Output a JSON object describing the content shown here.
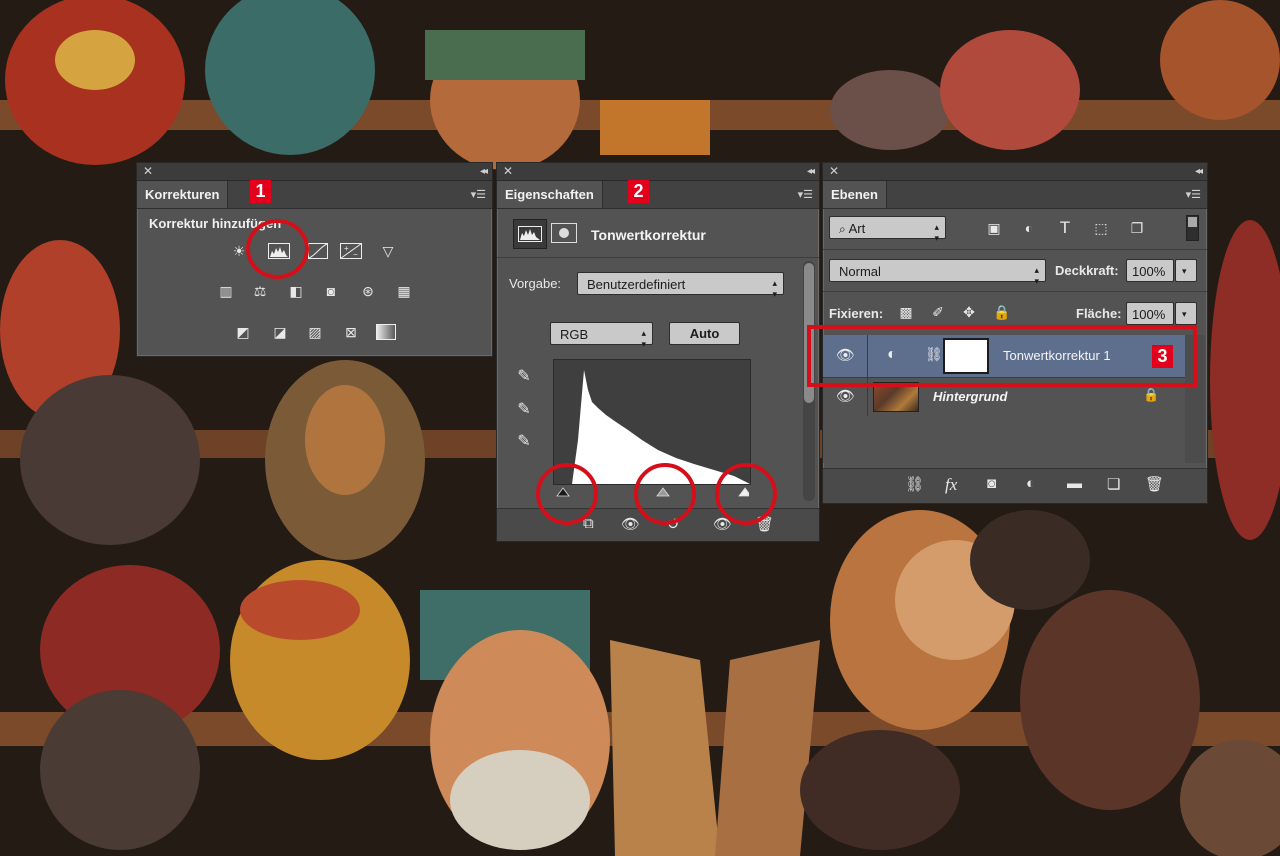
{
  "panels": {
    "korrekturen": {
      "tab_label": "Korrekturen",
      "section_title": "Korrektur hinzufügen",
      "badge": "1"
    },
    "eigenschaften": {
      "tab_label": "Eigenschaften",
      "badge": "2",
      "title": "Tonwertkorrektur",
      "preset_label": "Vorgabe:",
      "preset_value": "Benutzerdefiniert",
      "channel_value": "RGB",
      "auto_label": "Auto"
    },
    "ebenen": {
      "tab_label": "Ebenen",
      "badge": "3",
      "filter_value": "Art",
      "blend_mode": "Normal",
      "opacity_label": "Deckkraft:",
      "opacity_value": "100%",
      "lock_label": "Fixieren:",
      "fill_label": "Fläche:",
      "fill_value": "100%",
      "layers": [
        {
          "name": "Tonwertkorrektur 1",
          "selected": true
        },
        {
          "name": "Hintergrund",
          "selected": false
        }
      ],
      "fx_label": "fx"
    }
  },
  "icons": {
    "close": "close-icon",
    "collapse": "collapse-icon",
    "menu": "panel-menu-icon"
  },
  "colors": {
    "panel_bg": "#535353",
    "highlight_red": "#d40f1a",
    "badge_red": "#e3001b",
    "selected_layer": "#5e6f8e"
  }
}
